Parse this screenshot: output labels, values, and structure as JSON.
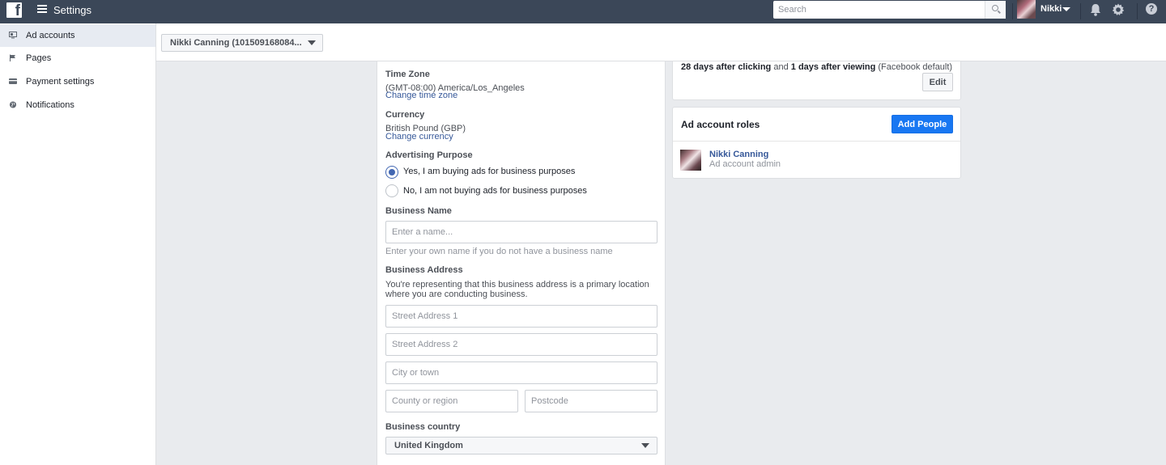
{
  "topbar": {
    "logo": "f",
    "title": "Settings",
    "search_placeholder": "Search",
    "user_name": "Nikki"
  },
  "sidebar": {
    "items": [
      {
        "label": "Ad accounts",
        "icon": "ad-accounts-icon"
      },
      {
        "label": "Pages",
        "icon": "flag-icon"
      },
      {
        "label": "Payment settings",
        "icon": "credit-card-icon"
      },
      {
        "label": "Notifications",
        "icon": "globe-icon"
      }
    ]
  },
  "account_selector": {
    "value": "Nikki Canning (101509168084..."
  },
  "settings": {
    "time_zone": {
      "label": "Time Zone",
      "value": "(GMT-08:00) America/Los_Angeles",
      "link": "Change time zone"
    },
    "currency": {
      "label": "Currency",
      "value": "British Pound (GBP)",
      "link": "Change currency"
    },
    "advertising_purpose": {
      "label": "Advertising Purpose",
      "options": [
        {
          "label": "Yes, I am buying ads for business purposes",
          "selected": true
        },
        {
          "label": "No, I am not buying ads for business purposes",
          "selected": false
        }
      ]
    },
    "business_name": {
      "label": "Business Name",
      "placeholder": "Enter a name...",
      "value": "",
      "hint": "Enter your own name if you do not have a business name"
    },
    "business_address": {
      "label": "Business Address",
      "description_line1": "You're representing that this business address is a primary location",
      "description_line2": "where you are conducting business.",
      "street1_placeholder": "Street Address 1",
      "street2_placeholder": "Street Address 2",
      "city_placeholder": "City or town",
      "county_placeholder": "County or region",
      "postcode_placeholder": "Postcode"
    },
    "business_country": {
      "label": "Business country",
      "value": "United Kingdom"
    }
  },
  "attribution": {
    "click_window": "28 days after clicking",
    "and": "and",
    "view_window": "1 days after viewing",
    "default_note": "(Facebook default)",
    "edit_label": "Edit"
  },
  "roles": {
    "title": "Ad account roles",
    "add_label": "Add People",
    "people": [
      {
        "name": "Nikki Canning",
        "role": "Ad account admin"
      }
    ]
  },
  "colors": {
    "topbar": "#3b4758",
    "accent_blue": "#1877f2",
    "link": "#365899",
    "active_item_bg": "#e7ebf2"
  }
}
